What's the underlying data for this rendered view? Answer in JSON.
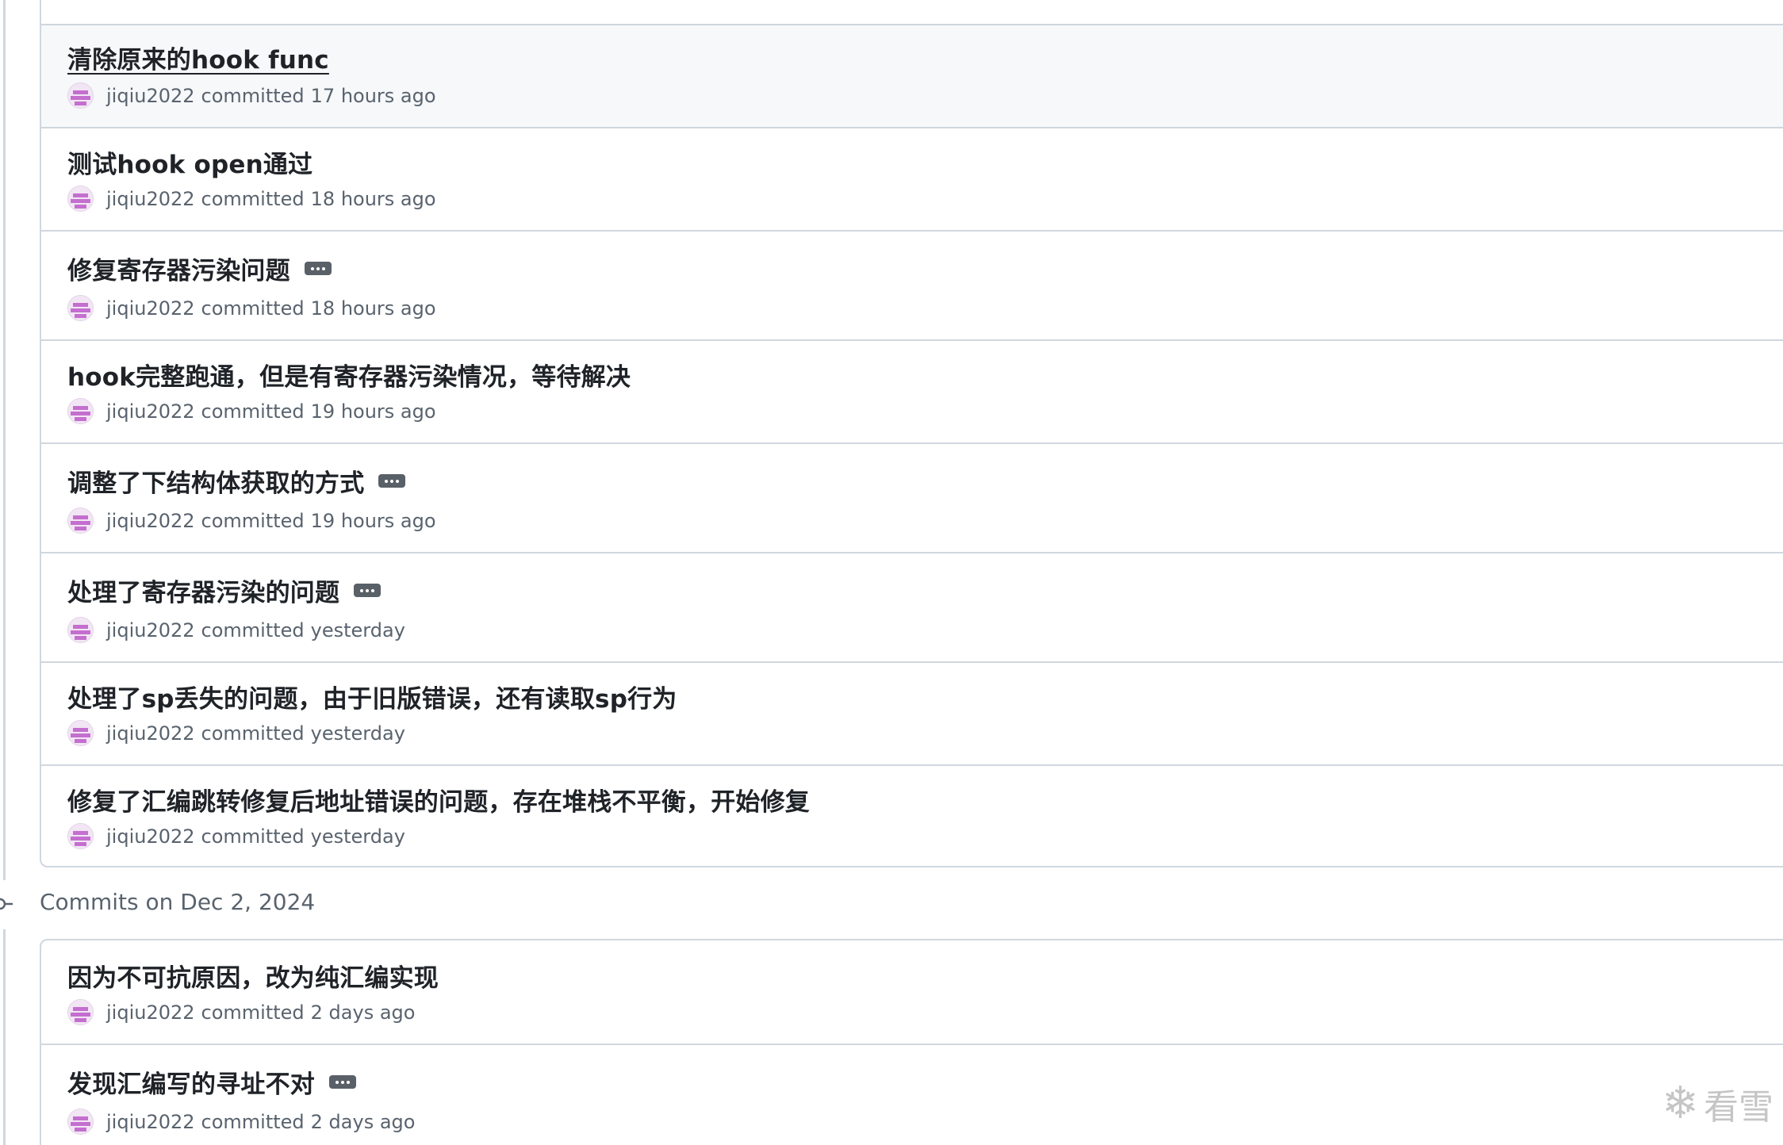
{
  "groups": [
    {
      "commits": [
        {
          "title": "清除原来的hook func",
          "author": "jiqiu2022",
          "verb": "committed",
          "time": "17 hours ago",
          "sha_hint": "7",
          "ellipsis": false
        },
        {
          "title": "测试hook open通过",
          "author": "jiqiu2022",
          "verb": "committed",
          "time": "18 hours ago",
          "sha_hint": "5",
          "ellipsis": false
        },
        {
          "title": "修复寄存器污染问题",
          "author": "jiqiu2022",
          "verb": "committed",
          "time": "18 hours ago",
          "sha_hint": "f",
          "ellipsis": true
        },
        {
          "title": "hook完整跑通，但是有寄存器污染情况，等待解决",
          "author": "jiqiu2022",
          "verb": "committed",
          "time": "19 hours ago",
          "sha_hint": "6",
          "ellipsis": false
        },
        {
          "title": "调整了下结构体获取的方式",
          "author": "jiqiu2022",
          "verb": "committed",
          "time": "19 hours ago",
          "sha_hint": "b",
          "ellipsis": true
        },
        {
          "title": "处理了寄存器污染的问题",
          "author": "jiqiu2022",
          "verb": "committed",
          "time": "yesterday",
          "sha_hint": "6",
          "ellipsis": true
        },
        {
          "title": "处理了sp丢失的问题，由于旧版错误，还有读取sp行为",
          "author": "jiqiu2022",
          "verb": "committed",
          "time": "yesterday",
          "sha_hint": "0",
          "ellipsis": false
        },
        {
          "title": "修复了汇编跳转修复后地址错误的问题，存在堆栈不平衡，开始修复",
          "author": "jiqiu2022",
          "verb": "committed",
          "time": "yesterday",
          "sha_hint": "f",
          "ellipsis": false
        }
      ]
    },
    {
      "date_header": "Commits on Dec 2, 2024",
      "commits": [
        {
          "title": "因为不可抗原因，改为纯汇编实现",
          "author": "jiqiu2022",
          "verb": "committed",
          "time": "2 days ago",
          "sha_hint": "3",
          "ellipsis": false
        },
        {
          "title": "发现汇编写的寻址不对",
          "author": "jiqiu2022",
          "verb": "committed",
          "time": "2 days ago",
          "sha_hint": "9",
          "ellipsis": true
        }
      ]
    }
  ],
  "watermark": {
    "text": "看雪",
    "icon": "snowflake-icon"
  }
}
